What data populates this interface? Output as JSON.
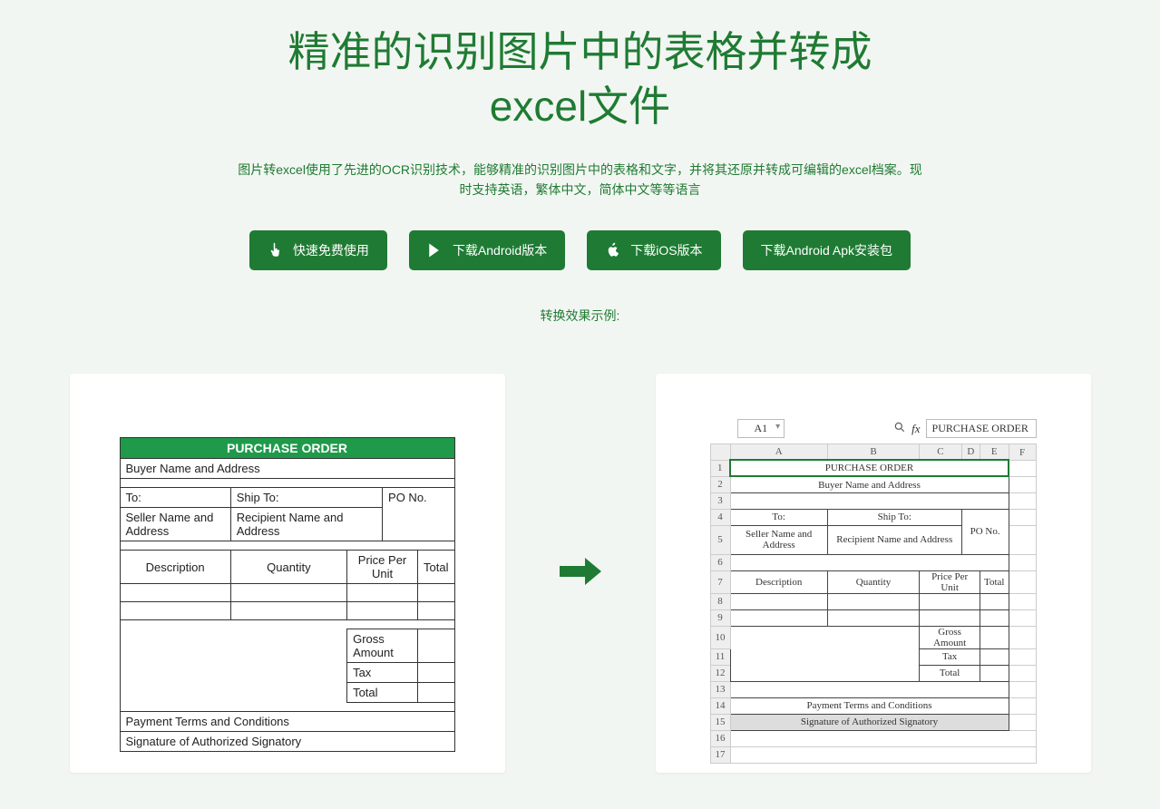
{
  "headline_l1": "精准的识别图片中的表格并转成",
  "headline_l2": "excel文件",
  "subtext": "图片转excel使用了先进的OCR识别技术，能够精准的识别图片中的表格和文字，并将其还原并转成可编辑的excel档案。现时支持英语，繁体中文，简体中文等等语言",
  "buttons": {
    "free": "快速免费使用",
    "android": "下载Android版本",
    "ios": "下载iOS版本",
    "apk": "下载Android Apk安装包"
  },
  "demo_label": "转换效果示例:",
  "source_table": {
    "title": "PURCHASE ORDER",
    "buyer": "Buyer Name and Address",
    "to": "To:",
    "ship_to": "Ship To:",
    "seller": "Seller Name and Address",
    "recipient": "Recipient Name and Address",
    "po_no": "PO No.",
    "desc": "Description",
    "qty": "Quantity",
    "ppu": "Price Per Unit",
    "total": "Total",
    "gross": "Gross Amount",
    "tax": "Tax",
    "total2": "Total",
    "pay": "Payment Terms and Conditions",
    "sig": "Signature of Authorized Signatory"
  },
  "excel": {
    "cell_ref": "A1",
    "fx_value": "PURCHASE ORDER",
    "cols": [
      "A",
      "B",
      "C",
      "D",
      "E",
      "F"
    ],
    "rows": {
      "1": "PURCHASE ORDER",
      "2": "Buyer Name and Address",
      "4_to": "To:",
      "4_ship": "Ship To:",
      "5_seller": "Seller Name and Address",
      "5_recip": "Recipient Name and Address",
      "5_po": "PO No.",
      "7_desc": "Description",
      "7_qty": "Quantity",
      "7_ppu": "Price Per Unit",
      "7_tot": "Total",
      "10": "Gross Amount",
      "11": "Tax",
      "12": "Total",
      "14": "Payment Terms and Conditions",
      "15": "Signature of Authorized Signatory"
    }
  }
}
